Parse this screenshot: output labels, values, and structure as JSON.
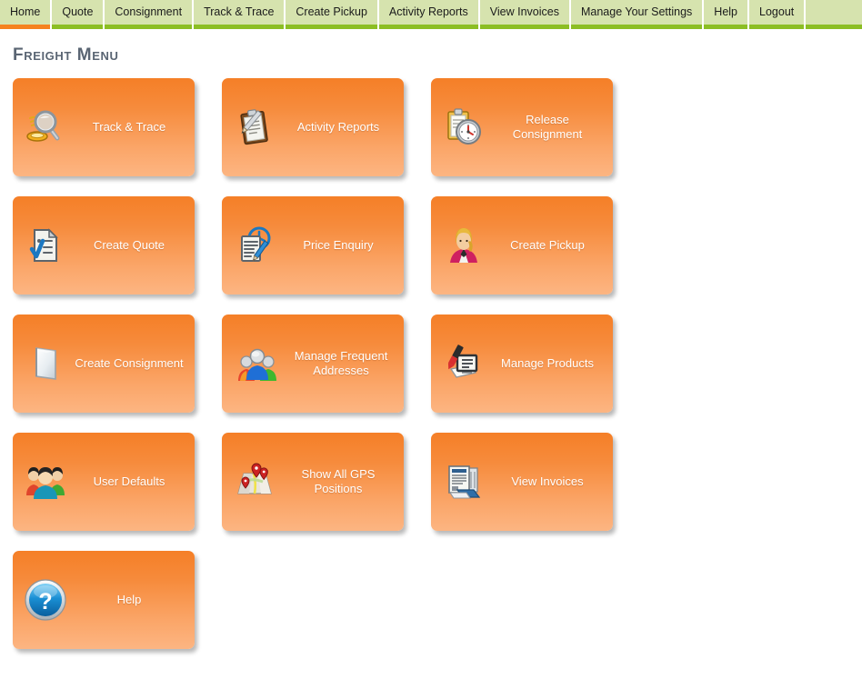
{
  "nav": {
    "items": [
      {
        "label": "Home",
        "active": true
      },
      {
        "label": "Quote",
        "active": false
      },
      {
        "label": "Consignment",
        "active": false
      },
      {
        "label": "Track & Trace",
        "active": false
      },
      {
        "label": "Create Pickup",
        "active": false
      },
      {
        "label": "Activity Reports",
        "active": false
      },
      {
        "label": "View Invoices",
        "active": false
      },
      {
        "label": "Manage Your Settings",
        "active": false
      },
      {
        "label": "Help",
        "active": false
      },
      {
        "label": "Logout",
        "active": false
      }
    ],
    "active_underline_color": "#f5821f",
    "inactive_underline_color": "#8cbe24",
    "tab_background_color": "#d6e3ae"
  },
  "page": {
    "title": "Freight Menu",
    "title_color": "#5a6573",
    "background_color": "#ffffff"
  },
  "tiles": {
    "accent_color_top": "#f57f27",
    "accent_color_bottom": "#fcb582",
    "label_color": "#ffffff",
    "items": [
      {
        "label": "Track & Trace",
        "icon": "magnifier-icon"
      },
      {
        "label": "Activity Reports",
        "icon": "clipboard-pencil-icon"
      },
      {
        "label": "Release Consignment",
        "icon": "clipboard-clock-icon"
      },
      {
        "label": "Create Quote",
        "icon": "document-check-icon"
      },
      {
        "label": "Price Enquiry",
        "icon": "document-clock-pencil-icon"
      },
      {
        "label": "Create Pickup",
        "icon": "person-icon"
      },
      {
        "label": "Create Consignment",
        "icon": "blank-page-icon"
      },
      {
        "label": "Manage Frequent Addresses",
        "icon": "people-group-icon"
      },
      {
        "label": "Manage Products",
        "icon": "documents-pen-icon"
      },
      {
        "label": "User Defaults",
        "icon": "users-icon"
      },
      {
        "label": "Show All GPS Positions",
        "icon": "map-pins-icon"
      },
      {
        "label": "View Invoices",
        "icon": "invoice-stack-icon"
      },
      {
        "label": "Help",
        "icon": "question-circle-icon"
      }
    ]
  }
}
